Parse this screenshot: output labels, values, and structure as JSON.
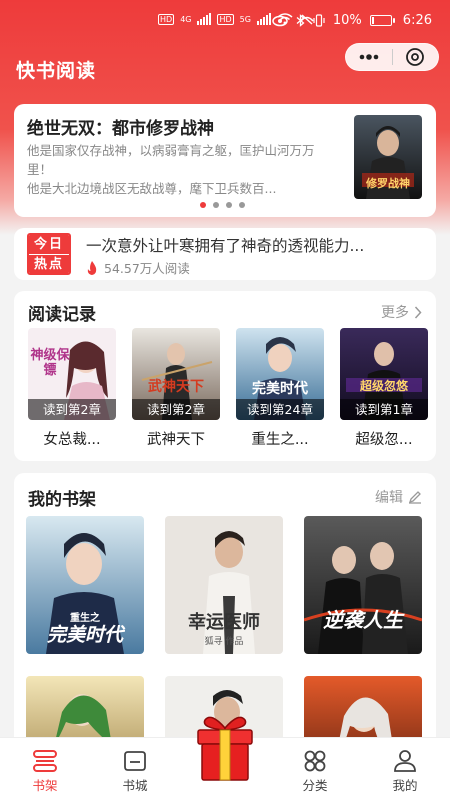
{
  "status_bar": {
    "hd1": "HD",
    "hd2": "HD",
    "net1": "4G",
    "net2": "5G",
    "battery": "10%",
    "time": "6:26"
  },
  "app": {
    "title": "快书阅读"
  },
  "featured": {
    "title": "绝世无双：都市修罗战神",
    "desc_line1": "他是国家仅存战神，以病弱膏肓之躯，匡护山河万万里！",
    "desc_line2": "他是大北边境战区无敌战尊，麾下卫兵数百...",
    "cover_text": "修罗战神",
    "dots": 4,
    "active_dot": 0
  },
  "hot": {
    "badge_top": "今日",
    "badge_bottom": "热点",
    "headline": "一次意外让叶寒拥有了神奇的透视能力...",
    "readers": "54.57万人阅读"
  },
  "history": {
    "title": "阅读记录",
    "more": "更多",
    "items": [
      {
        "name": "女总裁...",
        "progress": "读到第2章",
        "cover_text": "神级保镖"
      },
      {
        "name": "武神天下",
        "progress": "读到第2章",
        "cover_text": "武神天下"
      },
      {
        "name": "重生之...",
        "progress": "读到第24章",
        "cover_text": "完美时代"
      },
      {
        "name": "超级忽...",
        "progress": "读到第1章",
        "cover_text": "超级忽悠"
      }
    ]
  },
  "shelf": {
    "title": "我的书架",
    "edit": "编辑",
    "books": [
      {
        "cover_text": "完美时代",
        "sub": "重生之"
      },
      {
        "cover_text": "幸运医师",
        "sub": "狐寻 作品"
      },
      {
        "cover_text": "逆袭人生",
        "sub": ""
      },
      {
        "cover_text": "",
        "sub": ""
      },
      {
        "cover_text": "",
        "sub": ""
      },
      {
        "cover_text": "",
        "sub": ""
      }
    ]
  },
  "tabs": [
    {
      "label": "书架",
      "icon": "bookshelf-icon",
      "active": true
    },
    {
      "label": "书城",
      "icon": "bookstore-icon",
      "active": false
    },
    {
      "label": "",
      "icon": "gift-icon",
      "active": false
    },
    {
      "label": "分类",
      "icon": "category-icon",
      "active": false
    },
    {
      "label": "我的",
      "icon": "profile-icon",
      "active": false
    }
  ],
  "colors": {
    "accent": "#ee3b3b",
    "background": "#f3f3f3"
  }
}
